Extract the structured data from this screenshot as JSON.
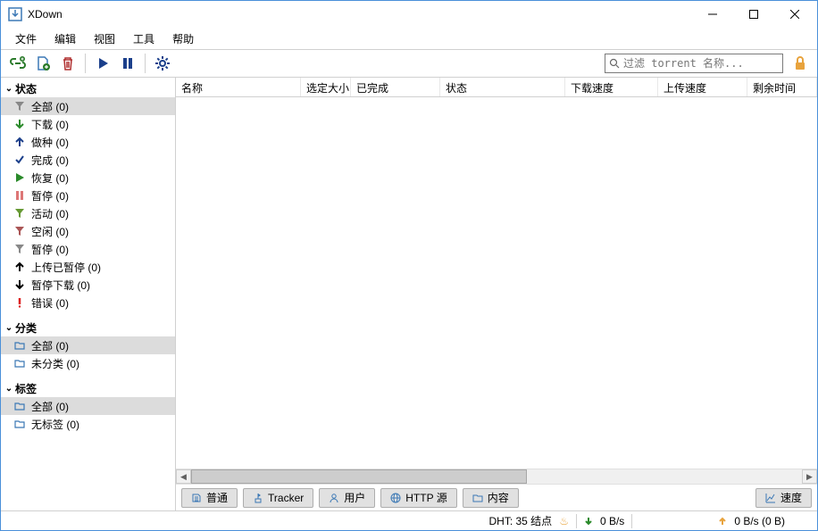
{
  "app": {
    "title": "XDown"
  },
  "menu": {
    "file": "文件",
    "edit": "编辑",
    "view": "视图",
    "tools": "工具",
    "help": "帮助"
  },
  "toolbar": {
    "search_placeholder": "过滤 torrent 名称..."
  },
  "sidebar": {
    "status_header": "状态",
    "status_items": [
      {
        "label": "全部 (0)"
      },
      {
        "label": "下载 (0)"
      },
      {
        "label": "做种 (0)"
      },
      {
        "label": "完成 (0)"
      },
      {
        "label": "恢复 (0)"
      },
      {
        "label": "暂停 (0)"
      },
      {
        "label": "活动 (0)"
      },
      {
        "label": "空闲 (0)"
      },
      {
        "label": "暂停 (0)"
      },
      {
        "label": "上传已暂停 (0)"
      },
      {
        "label": "暂停下载 (0)"
      },
      {
        "label": "错误 (0)"
      }
    ],
    "category_header": "分类",
    "category_items": [
      {
        "label": "全部 (0)"
      },
      {
        "label": "未分类 (0)"
      }
    ],
    "tags_header": "标签",
    "tags_items": [
      {
        "label": "全部 (0)"
      },
      {
        "label": "无标签 (0)"
      }
    ]
  },
  "columns": {
    "name": "名称",
    "size": "选定大小",
    "done": "已完成",
    "status": "状态",
    "dlspeed": "下载速度",
    "upspeed": "上传速度",
    "eta": "剩余时间"
  },
  "tabs": {
    "general": "普通",
    "tracker": "Tracker",
    "users": "用户",
    "http": "HTTP 源",
    "content": "内容",
    "speed": "速度"
  },
  "status": {
    "dht": "DHT: 35 结点",
    "down": "0 B/s",
    "up": "0 B/s (0 B)"
  }
}
